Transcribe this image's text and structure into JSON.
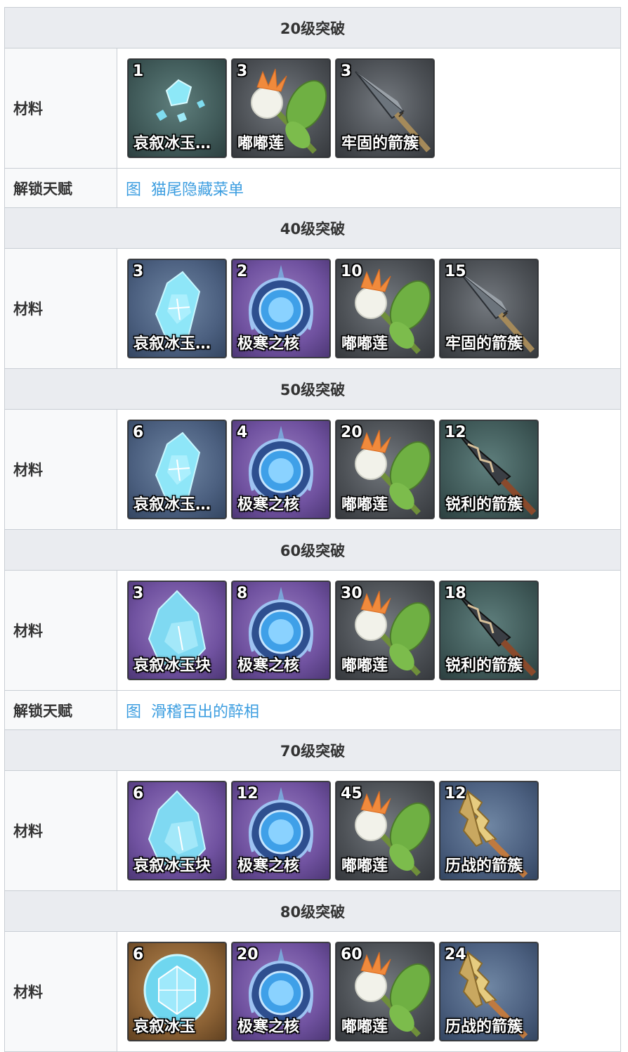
{
  "rows": [
    {
      "type": "head",
      "title": "20级突破"
    },
    {
      "type": "mat",
      "label": "材料",
      "items": [
        {
          "count": "1",
          "name": "哀叙冰玉…",
          "icon": "gem-shards-icon",
          "bg": "teal"
        },
        {
          "count": "3",
          "name": "嘟嘟莲",
          "icon": "calla-lily-icon",
          "bg": "gray"
        },
        {
          "count": "3",
          "name": "牢固的箭簇",
          "icon": "arrowhead-icon",
          "bg": "gray"
        }
      ]
    },
    {
      "type": "talent",
      "label": "解锁天赋",
      "img": "图",
      "text": "猫尾隐藏菜单"
    },
    {
      "type": "head",
      "title": "40级突破"
    },
    {
      "type": "mat",
      "label": "材料",
      "items": [
        {
          "count": "3",
          "name": "哀叙冰玉…",
          "icon": "gem-fragment-icon",
          "bg": "blue"
        },
        {
          "count": "2",
          "name": "极寒之核",
          "icon": "cryo-core-icon",
          "bg": "purple"
        },
        {
          "count": "10",
          "name": "嘟嘟莲",
          "icon": "calla-lily-icon",
          "bg": "gray"
        },
        {
          "count": "15",
          "name": "牢固的箭簇",
          "icon": "arrowhead-icon",
          "bg": "gray"
        }
      ]
    },
    {
      "type": "head",
      "title": "50级突破"
    },
    {
      "type": "mat",
      "label": "材料",
      "items": [
        {
          "count": "6",
          "name": "哀叙冰玉…",
          "icon": "gem-fragment-icon",
          "bg": "blue"
        },
        {
          "count": "4",
          "name": "极寒之核",
          "icon": "cryo-core-icon",
          "bg": "purple"
        },
        {
          "count": "20",
          "name": "嘟嘟莲",
          "icon": "calla-lily-icon",
          "bg": "gray"
        },
        {
          "count": "12",
          "name": "锐利的箭簇",
          "icon": "sharp-arrowhead-icon",
          "bg": "teal"
        }
      ]
    },
    {
      "type": "head",
      "title": "60级突破"
    },
    {
      "type": "mat",
      "label": "材料",
      "items": [
        {
          "count": "3",
          "name": "哀叙冰玉块",
          "icon": "gem-chunk-icon",
          "bg": "purple"
        },
        {
          "count": "8",
          "name": "极寒之核",
          "icon": "cryo-core-icon",
          "bg": "purple"
        },
        {
          "count": "30",
          "name": "嘟嘟莲",
          "icon": "calla-lily-icon",
          "bg": "gray"
        },
        {
          "count": "18",
          "name": "锐利的箭簇",
          "icon": "sharp-arrowhead-icon",
          "bg": "teal"
        }
      ]
    },
    {
      "type": "talent",
      "label": "解锁天赋",
      "img": "图",
      "text": "滑稽百出的醉相"
    },
    {
      "type": "head",
      "title": "70级突破"
    },
    {
      "type": "mat",
      "label": "材料",
      "items": [
        {
          "count": "6",
          "name": "哀叙冰玉块",
          "icon": "gem-chunk-icon",
          "bg": "purple"
        },
        {
          "count": "12",
          "name": "极寒之核",
          "icon": "cryo-core-icon",
          "bg": "purple"
        },
        {
          "count": "45",
          "name": "嘟嘟莲",
          "icon": "calla-lily-icon",
          "bg": "gray"
        },
        {
          "count": "12",
          "name": "历战的箭簇",
          "icon": "weathered-arrowhead-icon",
          "bg": "blue"
        }
      ]
    },
    {
      "type": "head",
      "title": "80级突破"
    },
    {
      "type": "mat",
      "label": "材料",
      "items": [
        {
          "count": "6",
          "name": "哀叙冰玉",
          "icon": "gem-gemstone-icon",
          "bg": "gold"
        },
        {
          "count": "20",
          "name": "极寒之核",
          "icon": "cryo-core-icon",
          "bg": "purple"
        },
        {
          "count": "60",
          "name": "嘟嘟莲",
          "icon": "calla-lily-icon",
          "bg": "gray"
        },
        {
          "count": "24",
          "name": "历战的箭簇",
          "icon": "weathered-arrowhead-icon",
          "bg": "blue"
        }
      ]
    }
  ]
}
